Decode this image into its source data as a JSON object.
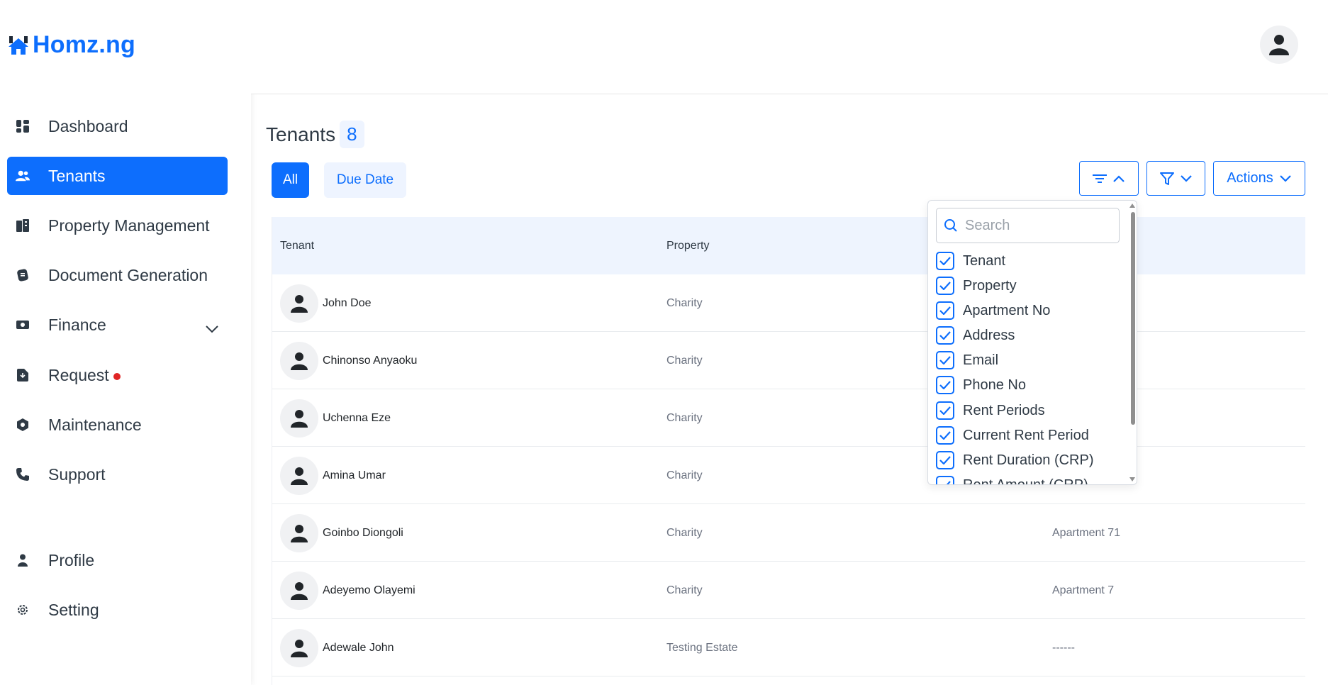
{
  "app": {
    "logo_text": "Homz.ng",
    "brand_color": "#0d6efd"
  },
  "sidebar": {
    "items": [
      {
        "label": "Dashboard",
        "icon": "dashboard-icon"
      },
      {
        "label": "Tenants",
        "icon": "users-icon",
        "active": true
      },
      {
        "label": "Property Management",
        "icon": "building-icon"
      },
      {
        "label": "Document Generation",
        "icon": "document-icon"
      },
      {
        "label": "Finance",
        "icon": "money-icon",
        "expandable": true
      },
      {
        "label": "Request",
        "icon": "request-icon",
        "notification": true
      },
      {
        "label": "Maintenance",
        "icon": "maintenance-icon"
      },
      {
        "label": "Support",
        "icon": "phone-icon"
      },
      {
        "label": "Profile",
        "icon": "person-icon"
      },
      {
        "label": "Setting",
        "icon": "gear-icon"
      }
    ]
  },
  "main": {
    "title": "Tenants",
    "count": "8",
    "tabs": [
      {
        "label": "All",
        "active": true
      },
      {
        "label": "Due Date",
        "active": false
      }
    ],
    "toolbar": {
      "actions_label": "Actions"
    }
  },
  "table": {
    "columns": [
      "Tenant",
      "Property"
    ],
    "rows": [
      {
        "name": "John Doe",
        "property": "Charity",
        "apartment": ""
      },
      {
        "name": "Chinonso Anyaoku",
        "property": "Charity",
        "apartment": ""
      },
      {
        "name": "Uchenna Eze",
        "property": "Charity",
        "apartment": ""
      },
      {
        "name": "Amina Umar",
        "property": "Charity",
        "apartment": ""
      },
      {
        "name": "Goinbo Diongoli",
        "property": "Charity",
        "apartment": "Apartment 71"
      },
      {
        "name": "Adeyemo Olayemi",
        "property": "Charity",
        "apartment": "Apartment 7"
      },
      {
        "name": "Adewale John",
        "property": "Testing Estate",
        "apartment": "------"
      }
    ]
  },
  "column_picker": {
    "search_placeholder": "Search",
    "options": [
      {
        "label": "Tenant",
        "checked": true
      },
      {
        "label": "Property",
        "checked": true
      },
      {
        "label": "Apartment No",
        "checked": true
      },
      {
        "label": "Address",
        "checked": true
      },
      {
        "label": "Email",
        "checked": true
      },
      {
        "label": "Phone No",
        "checked": true
      },
      {
        "label": "Rent Periods",
        "checked": true
      },
      {
        "label": "Current Rent Period",
        "checked": true
      },
      {
        "label": "Rent Duration (CRP)",
        "checked": true
      },
      {
        "label": "Rent Amount (CRP)",
        "checked": true
      }
    ]
  }
}
